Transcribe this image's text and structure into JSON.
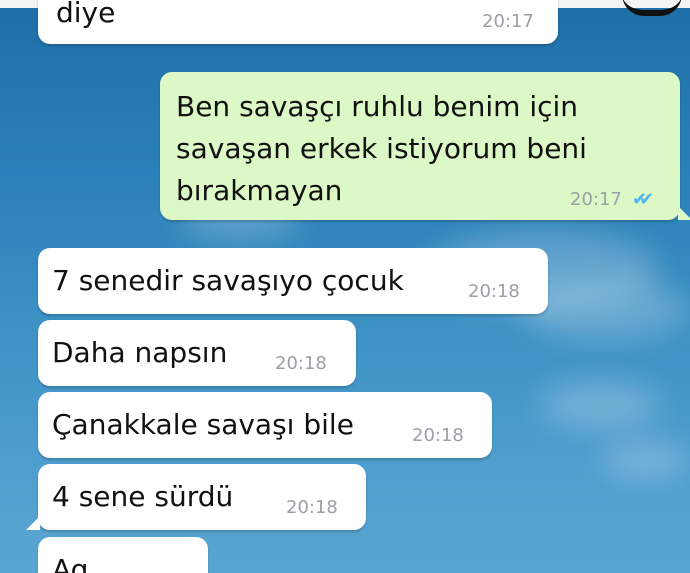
{
  "messages": [
    {
      "text": "diye",
      "time": "20:17",
      "direction": "incoming"
    },
    {
      "lines": [
        "Ben savaşçı ruhlu benim için",
        "savaşan erkek istiyorum beni",
        "bırakmayan"
      ],
      "time": "20:17",
      "direction": "outgoing",
      "read_ticks": "✔✔"
    },
    {
      "text": "7 senedir savaşıyo çocuk",
      "time": "20:18",
      "direction": "incoming"
    },
    {
      "text": "Daha napsın",
      "time": "20:18",
      "direction": "incoming"
    },
    {
      "text": "Çanakkale savaşı bile",
      "time": "20:18",
      "direction": "incoming"
    },
    {
      "text": "4 sene sürdü",
      "time": "20:18",
      "direction": "incoming"
    },
    {
      "text": "Aq",
      "direction": "incoming"
    }
  ],
  "colors": {
    "incoming_bubble": "#ffffff",
    "outgoing_bubble": "#dcf8c6",
    "timestamp": "#9aa0a6",
    "read_ticks": "#4fb6ec"
  }
}
